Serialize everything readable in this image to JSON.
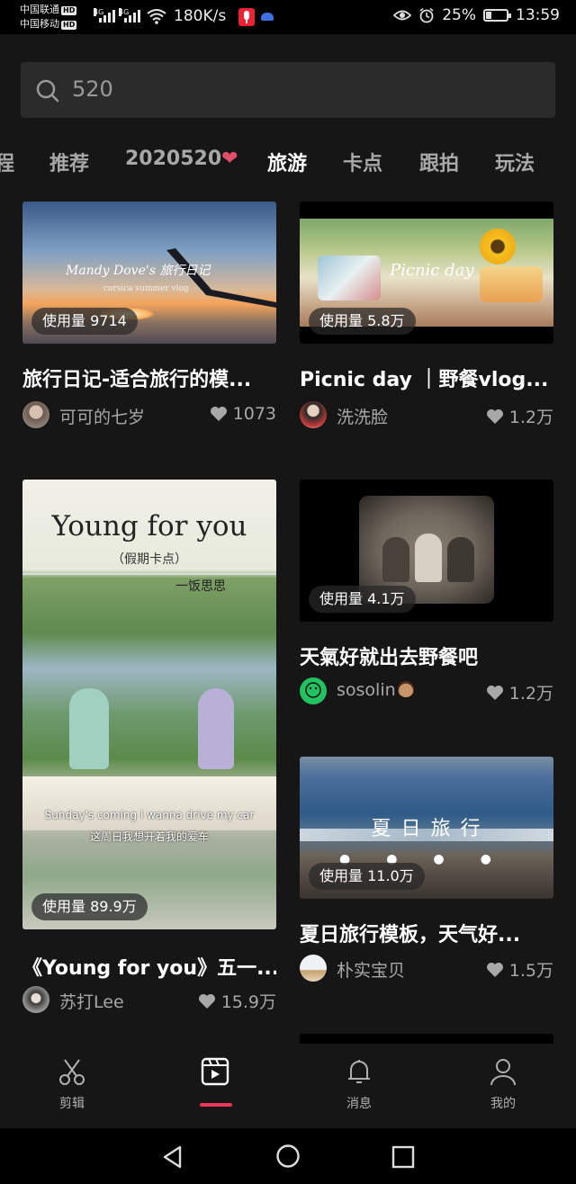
{
  "status_bar": {
    "carrier1": "中国联通",
    "carrier2": "中国移动",
    "hd": "HD",
    "net1": "4G",
    "net2": "4G",
    "speed": "180K/s",
    "battery": "25%",
    "battery_level": 0.25,
    "time": "13:59"
  },
  "search": {
    "query": "520"
  },
  "tabs": [
    "程",
    "推荐",
    "2020520",
    "旅游",
    "卡点",
    "跟拍",
    "玩法"
  ],
  "active_tab": "旅游",
  "cards": [
    {
      "usage": "使用量 9714",
      "title": "旅行日记-适合旅行的模...",
      "author": "可可的七岁",
      "likes": "1073"
    },
    {
      "usage": "使用量 5.8万",
      "title": "Picnic day ｜野餐vlog...",
      "author": "洗洗脸",
      "likes": "1.2万"
    },
    {
      "usage": "使用量 89.9万",
      "title": "《Young for you》五一...",
      "author": "苏打Lee",
      "likes": "15.9万"
    },
    {
      "usage": "使用量 4.1万",
      "title": "天氣好就出去野餐吧",
      "author": "sosolin",
      "likes": "1.2万"
    },
    {
      "usage": "使用量 11.0万",
      "title": "夏日旅行模板，天气好...",
      "author": "朴实宝贝",
      "likes": "1.5万"
    }
  ],
  "thumb_text": {
    "card1_caption": "Mandy Dove's 旅行日记",
    "card1_sub": "corsica summer vlog",
    "card2_caption": "Picnic day",
    "card3_title": "Young for you",
    "card3_sub": "（假期卡点）",
    "card3_author": "一饭思思",
    "card3_lyric_en": "Sunday's coming i wanna drive my car",
    "card3_lyric_zh": "这周日我想开着我的爱车",
    "card5_caption": "夏 日 旅 行"
  },
  "bottom_nav": [
    {
      "label": "剪辑",
      "icon": "scissors-icon"
    },
    {
      "label": "",
      "icon": "template-icon"
    },
    {
      "label": "消息",
      "icon": "bell-icon"
    },
    {
      "label": "我的",
      "icon": "profile-icon"
    }
  ],
  "colors": {
    "accent": "#f0345a",
    "background": "#161616"
  }
}
